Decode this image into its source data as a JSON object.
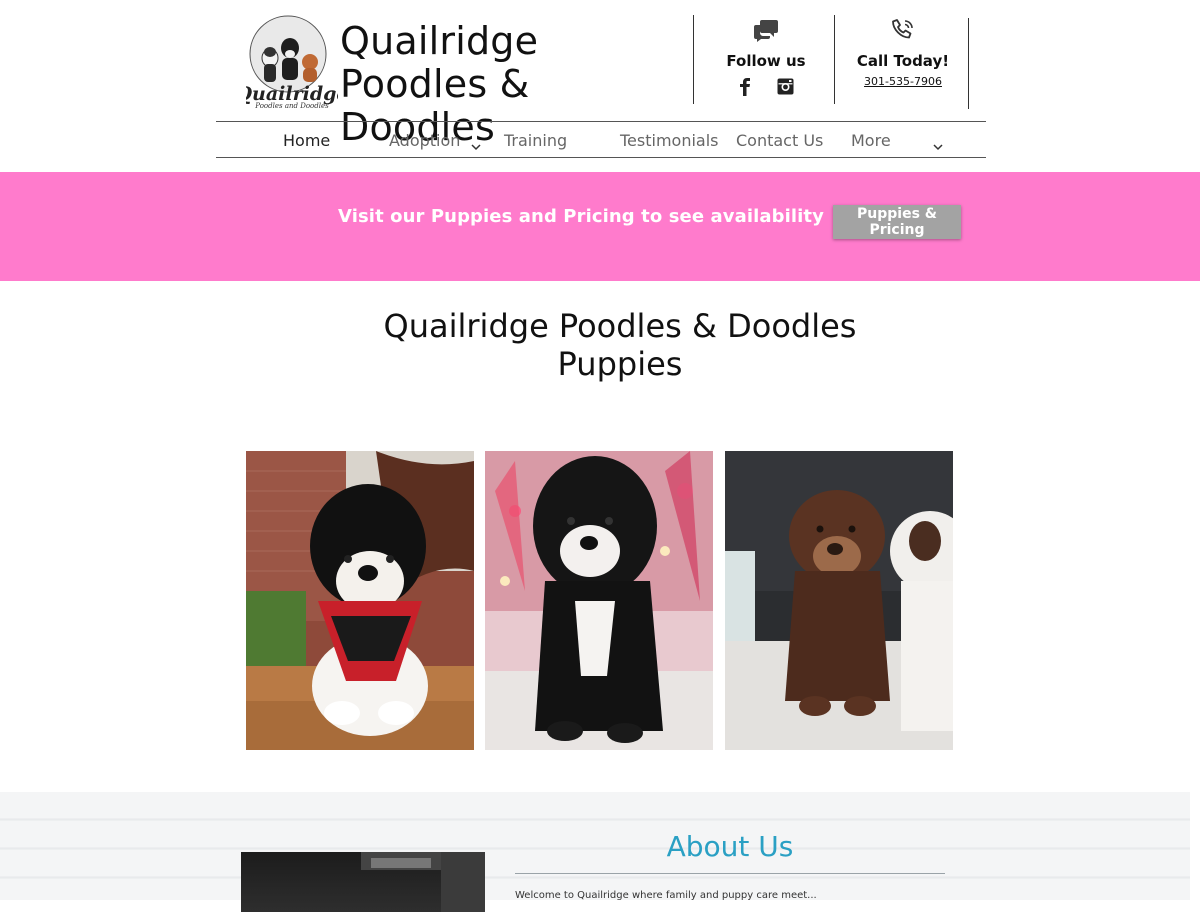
{
  "header": {
    "logo_text": "Quailridge",
    "logo_subtext": "Poodles and Doodles",
    "title": "Quailridge Poodles & Doodles",
    "follow_label": "Follow us",
    "call_label": "Call Today!",
    "phone": "301-535-7906",
    "follow_icon": "chat-bubbles-icon",
    "call_icon": "phone-icon",
    "social_icons": [
      "facebook-icon",
      "instagram-icon"
    ]
  },
  "nav": {
    "items": [
      {
        "label": "Home",
        "active": true
      },
      {
        "label": "Adoption",
        "dropdown": true
      },
      {
        "label": "Training"
      },
      {
        "label": "Testimonials"
      },
      {
        "label": "Contact Us"
      },
      {
        "label": "More",
        "dropdown": true
      }
    ]
  },
  "banner": {
    "text": "Visit our Puppies and Pricing to see availability",
    "button_label": "Puppies & Pricing",
    "background": "#ff7bcc"
  },
  "puppies": {
    "title_line1": "Quailridge Poodles & Doodles",
    "title_line2": "Puppies",
    "photos": [
      "puppy-photo-maryland-bandana",
      "puppy-photo-black-white",
      "puppy-photo-brown"
    ]
  },
  "about": {
    "title": "About Us",
    "text": "Welcome to Quailridge where family and puppy care meet..."
  },
  "colors": {
    "accent_pink": "#ff7bcc",
    "about_title": "#2aa0c4",
    "button_gray": "#a3a3a3"
  }
}
